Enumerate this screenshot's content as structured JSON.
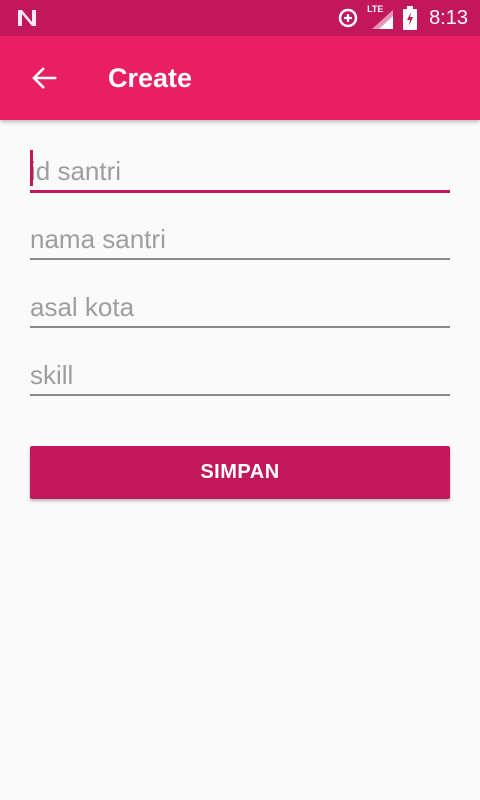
{
  "status_bar": {
    "time": "8:13",
    "network_label": "LTE",
    "icons": [
      "n-logo-icon",
      "data-saver-icon",
      "lte-signal-icon",
      "battery-charging-icon"
    ]
  },
  "app_bar": {
    "title": "Create",
    "back_icon": "arrow-back-icon"
  },
  "form": {
    "fields": [
      {
        "placeholder": "id santri",
        "value": "",
        "focused": true
      },
      {
        "placeholder": "nama santri",
        "value": ""
      },
      {
        "placeholder": "asal kota",
        "value": ""
      },
      {
        "placeholder": "skill",
        "value": ""
      }
    ],
    "submit_label": "SIMPAN"
  },
  "colors": {
    "status_bar": "#c2185b",
    "app_bar": "#e91e63",
    "accent": "#c2185b",
    "background": "#fafafa"
  }
}
